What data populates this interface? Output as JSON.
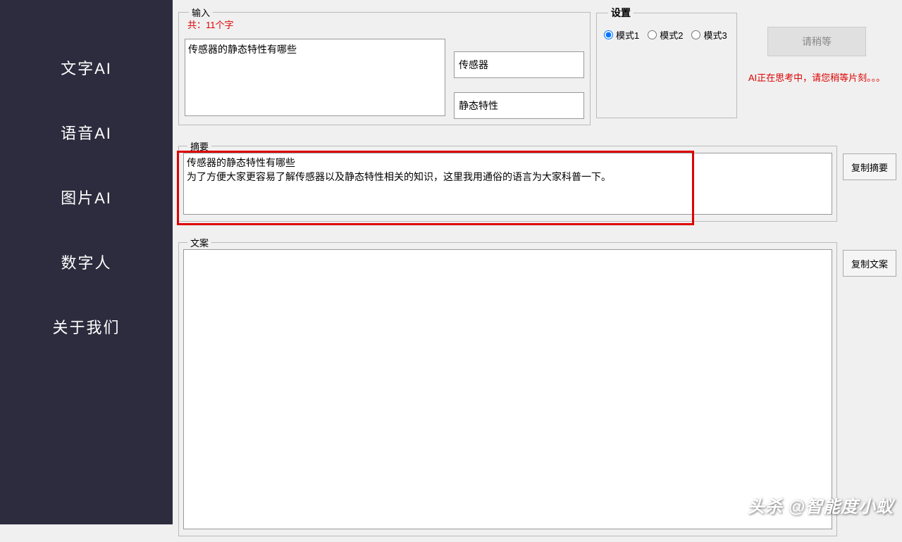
{
  "sidebar": {
    "items": [
      {
        "label": "文字AI"
      },
      {
        "label": "语音AI"
      },
      {
        "label": "图片AI"
      },
      {
        "label": "数字人"
      },
      {
        "label": "关于我们"
      }
    ]
  },
  "input": {
    "legend": "输入",
    "char_count": "共：11个字",
    "main_text": "传感器的静态特性有哪些",
    "keyword1": "传感器",
    "keyword2": "静态特性"
  },
  "settings": {
    "legend": "设置",
    "mode1": "模式1",
    "mode2": "模式2",
    "mode3": "模式3"
  },
  "action": {
    "wait_label": "请稍等",
    "thinking_text": "AI正在思考中，请您稍等片刻。。。"
  },
  "summary": {
    "legend": "摘要",
    "text": "传感器的静态特性有哪些\n为了方便大家更容易了解传感器以及静态特性相关的知识，这里我用通俗的语言为大家科普一下。",
    "copy_label": "复制摘要"
  },
  "article": {
    "legend": "文案",
    "text": "",
    "copy_label": "复制文案"
  },
  "watermark": "头杀 @智能度小蚁"
}
